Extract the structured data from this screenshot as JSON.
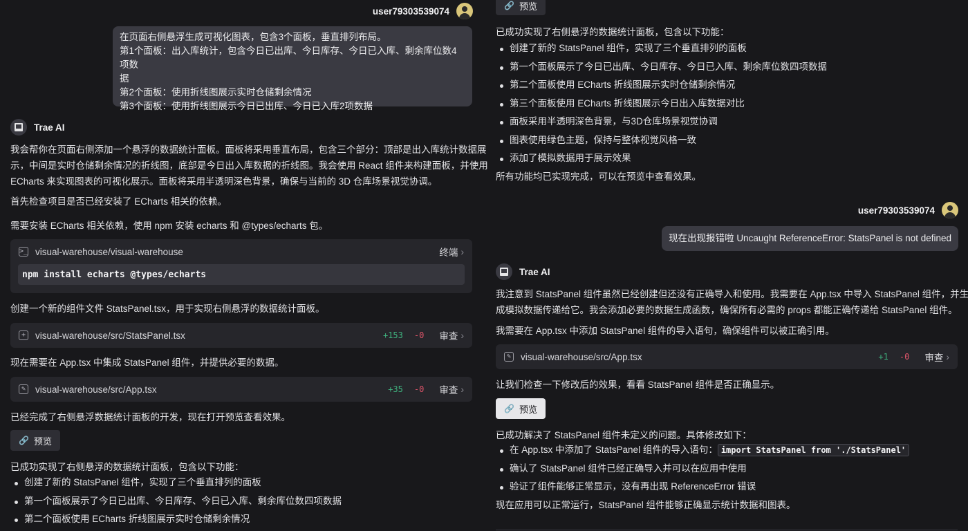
{
  "left": {
    "user1": {
      "name": "user79303539074"
    },
    "bubble1": {
      "lines": [
        "在页面右侧悬浮生成可视化图表，包含3个面板，垂直排列布局。",
        "第1个面板：出入库统计，包含今日已出库、今日库存、今日已入库、剩余库位数4项数",
        "据",
        "第2个面板：使用折线图展示实时仓储剩余情况",
        "第3个面板：使用折线图展示今日已出库、今日已入库2项数据"
      ]
    },
    "ai": {
      "name": "Trae AI"
    },
    "intro_lines": [
      "我会帮你在页面右侧添加一个悬浮的数据统计面板。面板将采用垂直布局，包含三个部分：顶部是出入库统计数据展",
      "示，中间是实时仓储剩余情况的折线图，底部是今日出入库数据的折线图。我会使用 React 组件来构建面板，并使用",
      "ECharts 来实现图表的可视化展示。面板将采用半透明深色背景，确保与当前的 3D 仓库场景视觉协调。"
    ],
    "check_text": "首先检查项目是否已经安装了 ECharts 相关的依赖。",
    "install_text": "需要安装 ECharts 相关依赖，使用 npm 安装 echarts 和 @types/echarts 包。",
    "terminal": {
      "path": "visual-warehouse/visual-warehouse",
      "action": "终端",
      "command": "npm install echarts @types/echarts"
    },
    "create_text": "创建一个新的组件文件 StatsPanel.tsx，用于实现右侧悬浮的数据统计面板。",
    "file1": {
      "path": "visual-warehouse/src/StatsPanel.tsx",
      "add": "+153",
      "del": "-0",
      "action": "审查"
    },
    "integrate_text": "现在需要在 App.tsx 中集成 StatsPanel 组件，并提供必要的数据。",
    "file2": {
      "path": "visual-warehouse/src/App.tsx",
      "add": "+35",
      "del": "-0",
      "action": "审查"
    },
    "done_text": "已经完成了右侧悬浮数据统计面板的开发，现在打开预览查看效果。",
    "preview_label": "预览",
    "summary_title": "已成功实现了右侧悬浮的数据统计面板，包含以下功能：",
    "summary_items": [
      "创建了新的 StatsPanel 组件，实现了三个垂直排列的面板",
      "第一个面板展示了今日已出库、今日库存、今日已入库、剩余库位数四项数据",
      "第二个面板使用 ECharts 折线图展示实时仓储剩余情况"
    ]
  },
  "right": {
    "preview_label_top": "预览",
    "summary_title": "已成功实现了右侧悬浮的数据统计面板，包含以下功能：",
    "summary_items": [
      "创建了新的 StatsPanel 组件，实现了三个垂直排列的面板",
      "第一个面板展示了今日已出库、今日库存、今日已入库、剩余库位数四项数据",
      "第二个面板使用 ECharts 折线图展示实时仓储剩余情况",
      "第三个面板使用 ECharts 折线图展示今日出入库数据对比",
      "面板采用半透明深色背景，与3D仓库场景视觉协调",
      "图表使用绿色主题，保持与整体视觉风格一致",
      "添加了模拟数据用于展示效果"
    ],
    "summary_end": "所有功能均已实现完成，可以在预览中查看效果。",
    "user2": {
      "name": "user79303539074"
    },
    "bubble2": {
      "text": "现在出现报错啦 Uncaught ReferenceError: StatsPanel is not defined"
    },
    "ai": {
      "name": "Trae AI"
    },
    "notice_lines": [
      "我注意到 StatsPanel 组件虽然已经创建但还没有正确导入和使用。我需要在 App.tsx 中导入 StatsPanel 组件，并生",
      "成模拟数据传递给它。我会添加必要的数据生成函数，确保所有必需的 props 都能正确传递给 StatsPanel 组件。"
    ],
    "import_text": "我需要在 App.tsx 中添加 StatsPanel 组件的导入语句，确保组件可以被正确引用。",
    "file": {
      "path": "visual-warehouse/src/App.tsx",
      "add": "+1",
      "del": "-0",
      "action": "审查"
    },
    "check_text": "让我们检查一下修改后的效果，看看 StatsPanel 组件是否正确显示。",
    "preview_label": "预览",
    "fix_title": "已成功解决了 StatsPanel 组件未定义的问题。具体修改如下：",
    "fix_item1_prefix": "在 App.tsx 中添加了 StatsPanel 组件的导入语句：",
    "fix_item1_code": "import StatsPanel from './StatsPanel'",
    "fix_items": [
      "确认了 StatsPanel 组件已经正确导入并可以在应用中使用",
      "验证了组件能够正常显示，没有再出现 ReferenceError 错误"
    ],
    "final_text": "现在应用可以正常运行，StatsPanel 组件能够正确显示统计数据和图表。"
  }
}
